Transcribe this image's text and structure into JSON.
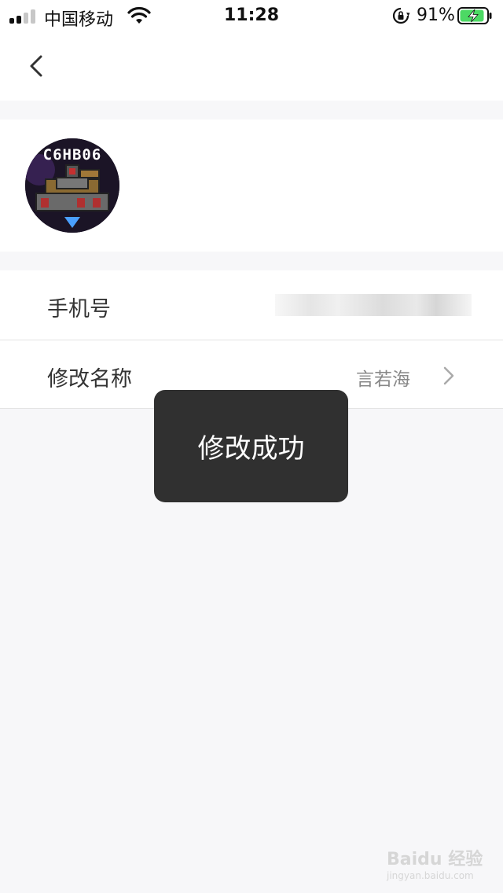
{
  "status_bar": {
    "carrier": "中国移动",
    "time": "11:28",
    "battery_percent": "91%",
    "battery_level": 0.91,
    "icons": [
      "signal-icon",
      "wifi-icon",
      "rotation-lock-icon",
      "battery-charging-icon"
    ]
  },
  "nav": {
    "back_icon": "chevron-left-icon"
  },
  "profile": {
    "avatar_text": "C6HB06"
  },
  "settings": {
    "phone_label": "手机号",
    "phone_value": "",
    "name_label": "修改名称",
    "name_value": "言若海",
    "name_icon": "chevron-right-icon"
  },
  "toast": {
    "message": "修改成功"
  },
  "watermark": {
    "brand": "Baidu 经验",
    "url": "jingyan.baidu.com"
  },
  "colors": {
    "background": "#f7f7f9",
    "toast_bg": "#303030",
    "battery_green": "#4cd964"
  }
}
